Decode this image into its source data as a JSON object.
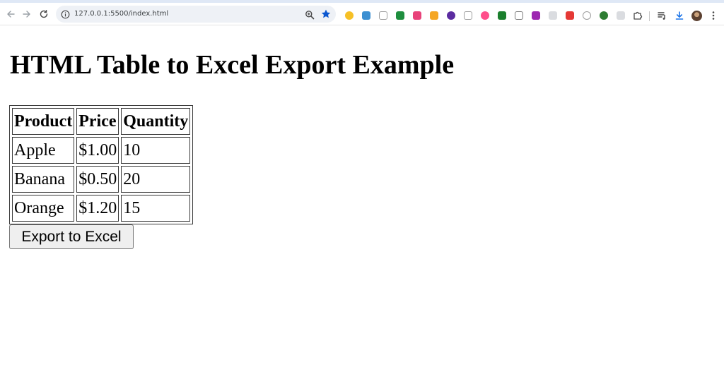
{
  "browser": {
    "url": "127.0.0.1:5500/index.html",
    "icons": {
      "back": "arrow-left-icon",
      "forward": "arrow-right-icon",
      "reload": "reload-icon",
      "site_info": "info-icon",
      "zoom": "zoom-icon",
      "bookmark": "star-icon",
      "extensions": "puzzle-icon",
      "downloads": "download-icon",
      "menu": "kebab-menu-icon"
    },
    "colors": {
      "bookmark_star": "#0b57d0",
      "omnibox_bg": "#eef1f6",
      "downloads_icon": "#1a73e8"
    }
  },
  "page": {
    "title": "HTML Table to Excel Export Example",
    "table": {
      "headers": [
        "Product",
        "Price",
        "Quantity"
      ],
      "rows": [
        [
          "Apple",
          "$1.00",
          "10"
        ],
        [
          "Banana",
          "$0.50",
          "20"
        ],
        [
          "Orange",
          "$1.20",
          "15"
        ]
      ]
    },
    "export_button_label": "Export to Excel"
  }
}
